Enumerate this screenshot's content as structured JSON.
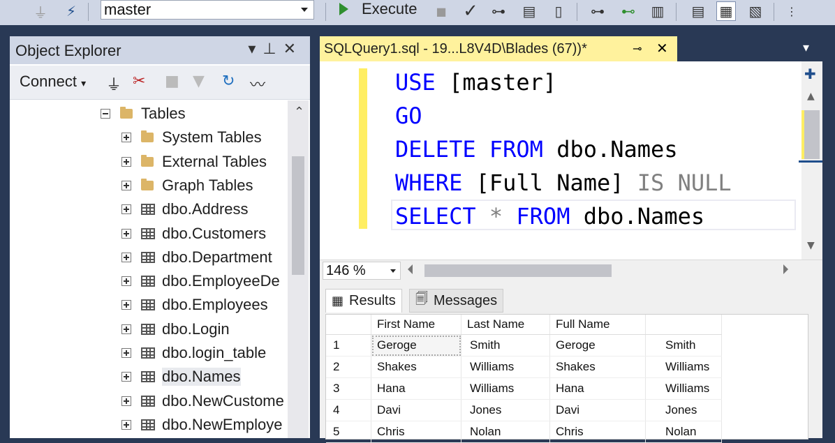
{
  "toolbar": {
    "database": "master",
    "execute_label": "Execute"
  },
  "object_explorer": {
    "title": "Object Explorer",
    "connect_label": "Connect",
    "tree": [
      {
        "label": "Tables",
        "kind": "folder",
        "expanded": true,
        "level": 0
      },
      {
        "label": "System Tables",
        "kind": "folder",
        "expanded": false,
        "level": 1
      },
      {
        "label": "External Tables",
        "kind": "folder",
        "expanded": false,
        "level": 1
      },
      {
        "label": "Graph Tables",
        "kind": "folder",
        "expanded": false,
        "level": 1
      },
      {
        "label": "dbo.Address",
        "kind": "table",
        "expanded": false,
        "level": 1
      },
      {
        "label": "dbo.Customers",
        "kind": "table",
        "expanded": false,
        "level": 1
      },
      {
        "label": "dbo.Department",
        "kind": "table",
        "expanded": false,
        "level": 1
      },
      {
        "label": "dbo.EmployeeDe",
        "kind": "table",
        "expanded": false,
        "level": 1
      },
      {
        "label": "dbo.Employees",
        "kind": "table",
        "expanded": false,
        "level": 1
      },
      {
        "label": "dbo.Login",
        "kind": "table",
        "expanded": false,
        "level": 1
      },
      {
        "label": "dbo.login_table",
        "kind": "table",
        "expanded": false,
        "level": 1
      },
      {
        "label": "dbo.Names",
        "kind": "table",
        "expanded": false,
        "level": 1,
        "selected": true
      },
      {
        "label": "dbo.NewCustome",
        "kind": "table",
        "expanded": false,
        "level": 1
      },
      {
        "label": "dbo.NewEmploye",
        "kind": "table",
        "expanded": false,
        "level": 1
      }
    ]
  },
  "editor": {
    "tab_title": "SQLQuery1.sql - 19...L8V4D\\Blades (67))*",
    "lines": [
      [
        {
          "t": "USE",
          "c": "kw"
        },
        {
          "t": " [master]",
          "c": ""
        }
      ],
      [
        {
          "t": "GO",
          "c": "kw"
        }
      ],
      [
        {
          "t": "DELETE",
          "c": "kw"
        },
        {
          "t": " ",
          "c": ""
        },
        {
          "t": "FROM",
          "c": "kw"
        },
        {
          "t": " dbo.Names",
          "c": ""
        }
      ],
      [
        {
          "t": "WHERE",
          "c": "kw"
        },
        {
          "t": " [Full Name] ",
          "c": ""
        },
        {
          "t": "IS NULL",
          "c": "gray"
        }
      ],
      [
        {
          "t": "SELECT",
          "c": "kw"
        },
        {
          "t": " * ",
          "c": "gray"
        },
        {
          "t": "FROM",
          "c": "kw"
        },
        {
          "t": " dbo.Names",
          "c": ""
        }
      ]
    ],
    "zoom": "146 %"
  },
  "results": {
    "tabs": [
      "Results",
      "Messages"
    ],
    "columns": [
      "",
      "First Name",
      "Last Name",
      "Full Name",
      ""
    ],
    "rows": [
      [
        "1",
        "Geroge",
        "Smith",
        "Geroge",
        "Smith"
      ],
      [
        "2",
        "Shakes",
        "Williams",
        "Shakes",
        "Williams"
      ],
      [
        "3",
        "Hana",
        "Williams",
        "Hana",
        "Williams"
      ],
      [
        "4",
        "Davi",
        "Jones",
        "Davi",
        "Jones"
      ],
      [
        "5",
        "Chris",
        "Nolan",
        "Chris",
        "Nolan"
      ]
    ]
  }
}
